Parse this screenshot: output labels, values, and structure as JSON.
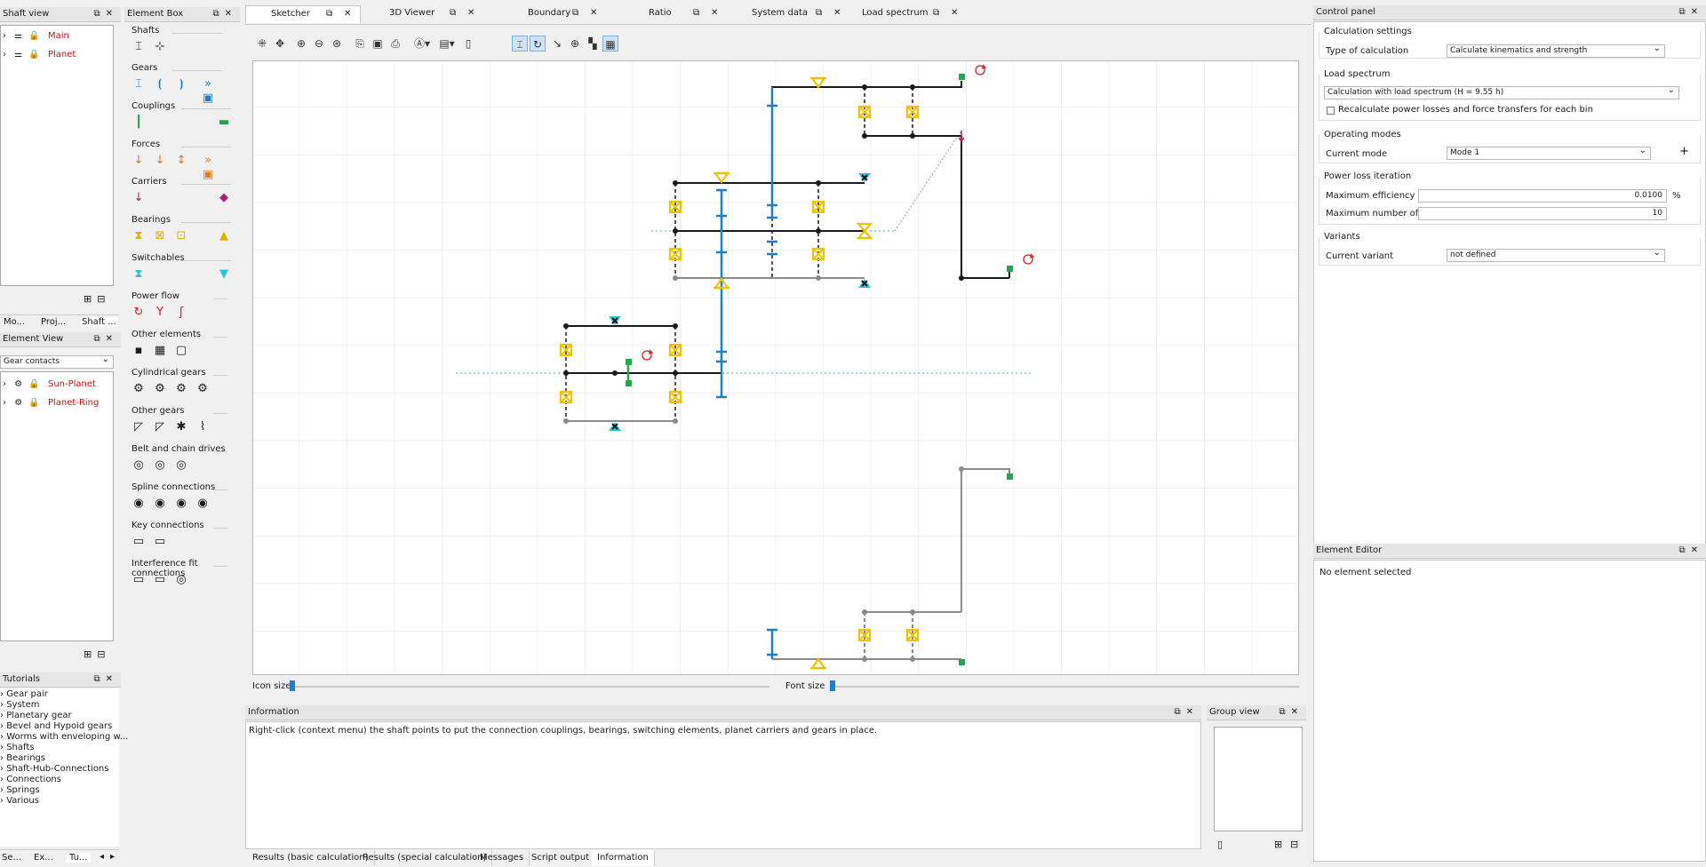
{
  "shaft_view": {
    "title": "Shaft view",
    "items": [
      {
        "label": "Main"
      },
      {
        "label": "Planet"
      }
    ],
    "tabs": [
      {
        "label": "Mo..."
      },
      {
        "label": "Proj..."
      },
      {
        "label": "Shaft ..."
      }
    ]
  },
  "element_view": {
    "title": "Element View",
    "filter": "Gear contacts",
    "items": [
      {
        "label": "Sun-Planet"
      },
      {
        "label": "Planet-Ring"
      }
    ]
  },
  "tutorials": {
    "title": "Tutorials",
    "items": [
      {
        "label": "Gear pair"
      },
      {
        "label": "System"
      },
      {
        "label": "Planetary gear"
      },
      {
        "label": "Bevel and Hypoid gears"
      },
      {
        "label": "Worms with enveloping w..."
      },
      {
        "label": "Shafts"
      },
      {
        "label": "Bearings"
      },
      {
        "label": "Shaft-Hub-Connections"
      },
      {
        "label": "Connections"
      },
      {
        "label": "Springs"
      },
      {
        "label": "Various"
      }
    ],
    "tabs": [
      {
        "label": "Se..."
      },
      {
        "label": "Ex..."
      },
      {
        "label": "Tu..."
      }
    ]
  },
  "element_box": {
    "title": "Element Box",
    "groups": [
      {
        "label": "Shafts"
      },
      {
        "label": "Gears"
      },
      {
        "label": "Couplings"
      },
      {
        "label": "Forces"
      },
      {
        "label": "Carriers"
      },
      {
        "label": "Bearings"
      },
      {
        "label": "Switchables"
      },
      {
        "label": "Power flow"
      },
      {
        "label": "Other elements"
      },
      {
        "label": "Cylindrical gears"
      },
      {
        "label": "Other gears"
      },
      {
        "label": "Belt and chain drives"
      },
      {
        "label": "Spline connections"
      },
      {
        "label": "Key connections"
      },
      {
        "label": "Interference fit connections"
      }
    ]
  },
  "tabs": [
    {
      "label": "Sketcher"
    },
    {
      "label": "3D Viewer"
    },
    {
      "label": "Boundary"
    },
    {
      "label": "Ratio"
    },
    {
      "label": "System data"
    },
    {
      "label": "Load spectrum"
    }
  ],
  "sketch": {
    "icon_size_label": "Icon size",
    "font_size_label": "Font size",
    "icon_size": 0.0,
    "font_size": 0.0
  },
  "information": {
    "title": "Information",
    "text": "Right-click (context menu) the shaft points to put the connection couplings, bearings, switching elements, planet carriers and gears in place."
  },
  "group_view": {
    "title": "Group view"
  },
  "bottom_tabs": [
    {
      "label": "Results (basic calculation)"
    },
    {
      "label": "Results (special calculation)"
    },
    {
      "label": "Messages"
    },
    {
      "label": "Script output"
    },
    {
      "label": "Information"
    }
  ],
  "control_panel": {
    "title": "Control panel",
    "calc_settings": {
      "header": "Calculation settings",
      "type_label": "Type of calculation",
      "type_value": "Calculate kinematics and strength"
    },
    "load_spectrum": {
      "header": "Load spectrum",
      "value": "Calculation with load spectrum (H = 9.55 h)",
      "checkbox_label": "Recalculate power losses and force transfers for each bin"
    },
    "operating_modes": {
      "header": "Operating modes",
      "current_label": "Current mode",
      "current_value": "Mode 1"
    },
    "power_loss": {
      "header": "Power loss iteration",
      "max_dev_label": "Maximum efficiency deviation",
      "max_dev_value": "0.0100",
      "max_dev_unit": "%",
      "max_iter_label": "Maximum number of iterations",
      "max_iter_value": "10"
    },
    "variants": {
      "header": "Variants",
      "current_label": "Current variant",
      "current_value": "not defined"
    }
  },
  "element_editor": {
    "title": "Element Editor",
    "text": "No element selected"
  },
  "colors": {
    "bearing": "#f2c200",
    "shaft": "#1a1a1a",
    "gear": "#1f7fc6",
    "coupling": "#22a84a",
    "switchable": "#27c3d6",
    "carrier": "#b0206e"
  }
}
